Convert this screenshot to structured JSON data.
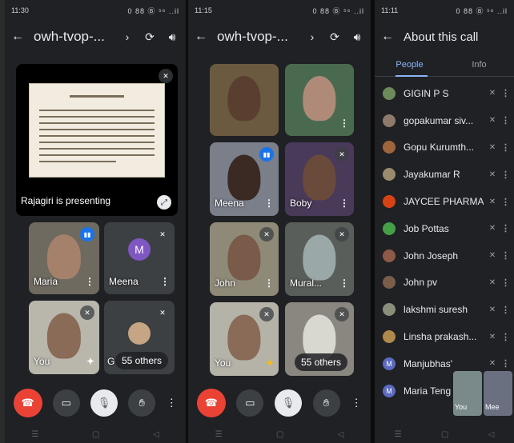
{
  "phones": {
    "p1": {
      "status_time": "11:30",
      "status_right": "0 88 Ⓑ ⁵⁶ ..il",
      "meeting_code": "owh-tvop-...",
      "presenting_label": "Rajagiri is presenting",
      "tiles": [
        {
          "name": "Maria"
        },
        {
          "name": "Meena",
          "initial": "M"
        },
        {
          "name": "You"
        },
        {
          "name": "G",
          "others": "55 others"
        }
      ]
    },
    "p2": {
      "status_time": "11:15",
      "status_right": "0 88 Ⓑ ⁵⁶ ..il",
      "meeting_code": "owh-tvop-...",
      "tiles": [
        {
          "name": ""
        },
        {
          "name": ""
        },
        {
          "name": "Meena"
        },
        {
          "name": "Boby"
        },
        {
          "name": "John"
        },
        {
          "name": "Mural..."
        },
        {
          "name": "You"
        },
        {
          "name": "",
          "others": "55 others"
        }
      ]
    },
    "p3": {
      "status_time": "11:11",
      "status_right": "0 88 Ⓑ ⁵⁶ ..il",
      "title": "About this call",
      "tab_people": "People",
      "tab_info": "Info",
      "people": [
        {
          "name": "GIGIN P S",
          "color": "#6d8b5a"
        },
        {
          "name": "gopakumar siv...",
          "color": "#8d7a6a"
        },
        {
          "name": "Gopu Kurumth...",
          "color": "#a0643c"
        },
        {
          "name": "Jayakumar R",
          "color": "#9a8a6e"
        },
        {
          "name": "JAYCEE PHARMA",
          "color": "#d84315"
        },
        {
          "name": "Job Pottas",
          "color": "#43a047"
        },
        {
          "name": "John Joseph",
          "color": "#8d5a48"
        },
        {
          "name": "John pv",
          "color": "#7b5e4a"
        },
        {
          "name": "lakshmi suresh",
          "color": "#8a8f7a"
        },
        {
          "name": "Linsha prakash...",
          "color": "#b08a4a"
        },
        {
          "name": "Manjubhas'",
          "color": "#5c6bc0",
          "initial": "M"
        },
        {
          "name": "Maria Teng",
          "color": "#5c6bc0",
          "initial": "M"
        }
      ],
      "mini_labels": [
        "You",
        "Mee"
      ]
    }
  },
  "colors": {
    "end_call": "#ea4335",
    "accent": "#8ab4f8",
    "speaking": "#1a73e8"
  }
}
